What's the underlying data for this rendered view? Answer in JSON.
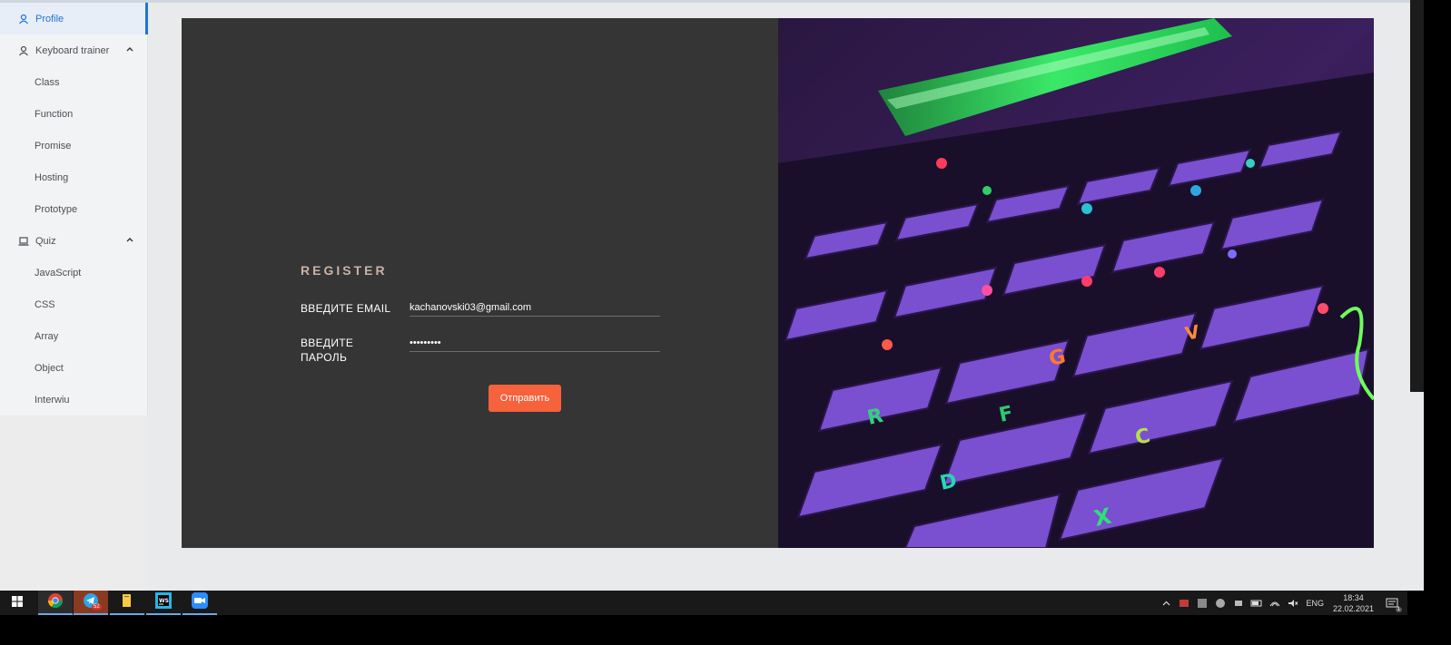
{
  "sidebar": {
    "profile": "Profile",
    "keyboard_trainer": "Keyboard trainer",
    "keyboard_items": [
      "Class",
      "Function",
      "Promise",
      "Hosting",
      "Prototype"
    ],
    "quiz": "Quiz",
    "quiz_items": [
      "JavaScript",
      "CSS",
      "Array",
      "Object",
      "Interwiu"
    ]
  },
  "form": {
    "title": "REGISTER",
    "email_label": "ВВЕДИТЕ EMAIL",
    "email_value": "kachanovski03@gmail.com",
    "password_label": "ВВЕДИТЕ ПАРОЛЬ",
    "password_value": "•••••••••",
    "submit_label": "Отправить"
  },
  "colors": {
    "accent_blue": "#1f74d6",
    "submit_orange": "#f5623b",
    "panel_bg": "#353535"
  },
  "taskbar": {
    "apps": [
      "chrome-icon",
      "telegram-icon",
      "file-explorer-icon",
      "webstorm-icon",
      "zoom-icon"
    ],
    "telegram_badge": "52",
    "language": "ENG",
    "time": "18:34",
    "date": "22.02.2021",
    "notification_count": "1"
  }
}
